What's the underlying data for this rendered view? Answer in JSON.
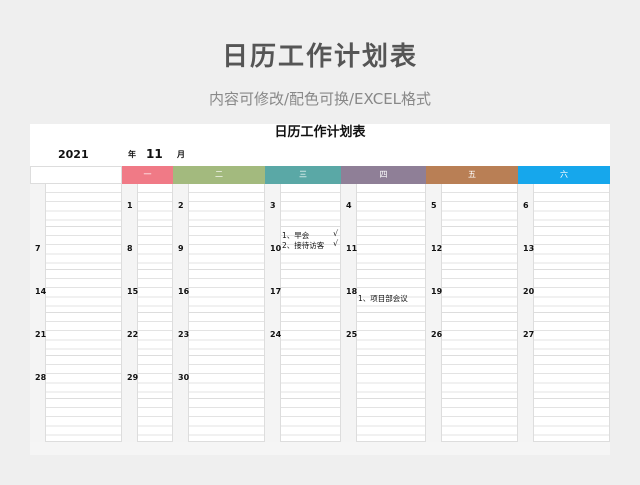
{
  "page_title": "日历工作计划表",
  "page_subtitle": "内容可修改/配色可换/EXCEL格式",
  "sheet": {
    "title": "日历工作计划表",
    "year": "2021",
    "year_label": "年",
    "month": "11",
    "month_label": "月"
  },
  "weekdays": [
    {
      "label": "一",
      "color": "#f07a86"
    },
    {
      "label": "二",
      "color": "#a3ba7e"
    },
    {
      "label": "三",
      "color": "#5aa8a6"
    },
    {
      "label": "四",
      "color": "#8f7f97"
    },
    {
      "label": "五",
      "color": "#b97f55"
    },
    {
      "label": "六",
      "color": "#16a7ec"
    }
  ],
  "weeks": [
    [
      "",
      "1",
      "2",
      "3",
      "4",
      "5",
      "6"
    ],
    [
      "7",
      "8",
      "9",
      "10",
      "11",
      "12",
      "13"
    ],
    [
      "14",
      "15",
      "16",
      "17",
      "18",
      "19",
      "20"
    ],
    [
      "21",
      "22",
      "23",
      "24",
      "25",
      "26",
      "27"
    ],
    [
      "28",
      "29",
      "30",
      "",
      "",
      "",
      ""
    ],
    [
      "",
      "",
      "",
      "",
      "",
      "",
      ""
    ]
  ],
  "notes": {
    "d10": [
      {
        "text": "1、早会",
        "check": "√"
      },
      {
        "text": "2、接待访客",
        "check": "√"
      }
    ],
    "d18": [
      {
        "text": "1、项目部会议",
        "check": ""
      }
    ]
  }
}
